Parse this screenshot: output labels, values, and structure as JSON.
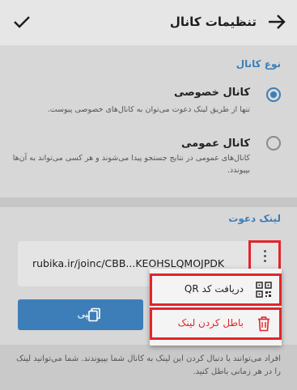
{
  "header": {
    "title": "تنظیمات کانال",
    "back_icon": "arrow-right-icon",
    "confirm_icon": "check-icon"
  },
  "channel_type": {
    "section_title": "نوع کانال",
    "options": [
      {
        "title": "کانال خصوصی",
        "description": "تنها از طریق لینک دعوت می‌توان به کانال‌های خصوصی پیوست.",
        "selected": true
      },
      {
        "title": "کانال عمومی",
        "description": "کانال‌های عمومی در نتایج جستجو پیدا می‌شوند و هر کسی می‌تواند به آن‌ها بپیوندد.",
        "selected": false
      }
    ]
  },
  "invite_link": {
    "section_title": "لینک دعوت",
    "link": "rubika.ir/joinc/CBB...KEOHSLQMOJPDK",
    "copy_label": "کپی",
    "menu": {
      "qr_label": "دریافت کد QR",
      "revoke_label": "باطل کردن لینک"
    }
  },
  "footer": {
    "text": "افراد می‌توانند با دنبال کردن این لینک به کانال شما بپیوندند. شما می‌توانید لینک را در هر زمانی باطل کنید."
  },
  "colors": {
    "accent": "#3d7eb8",
    "highlight": "#e2252b"
  }
}
